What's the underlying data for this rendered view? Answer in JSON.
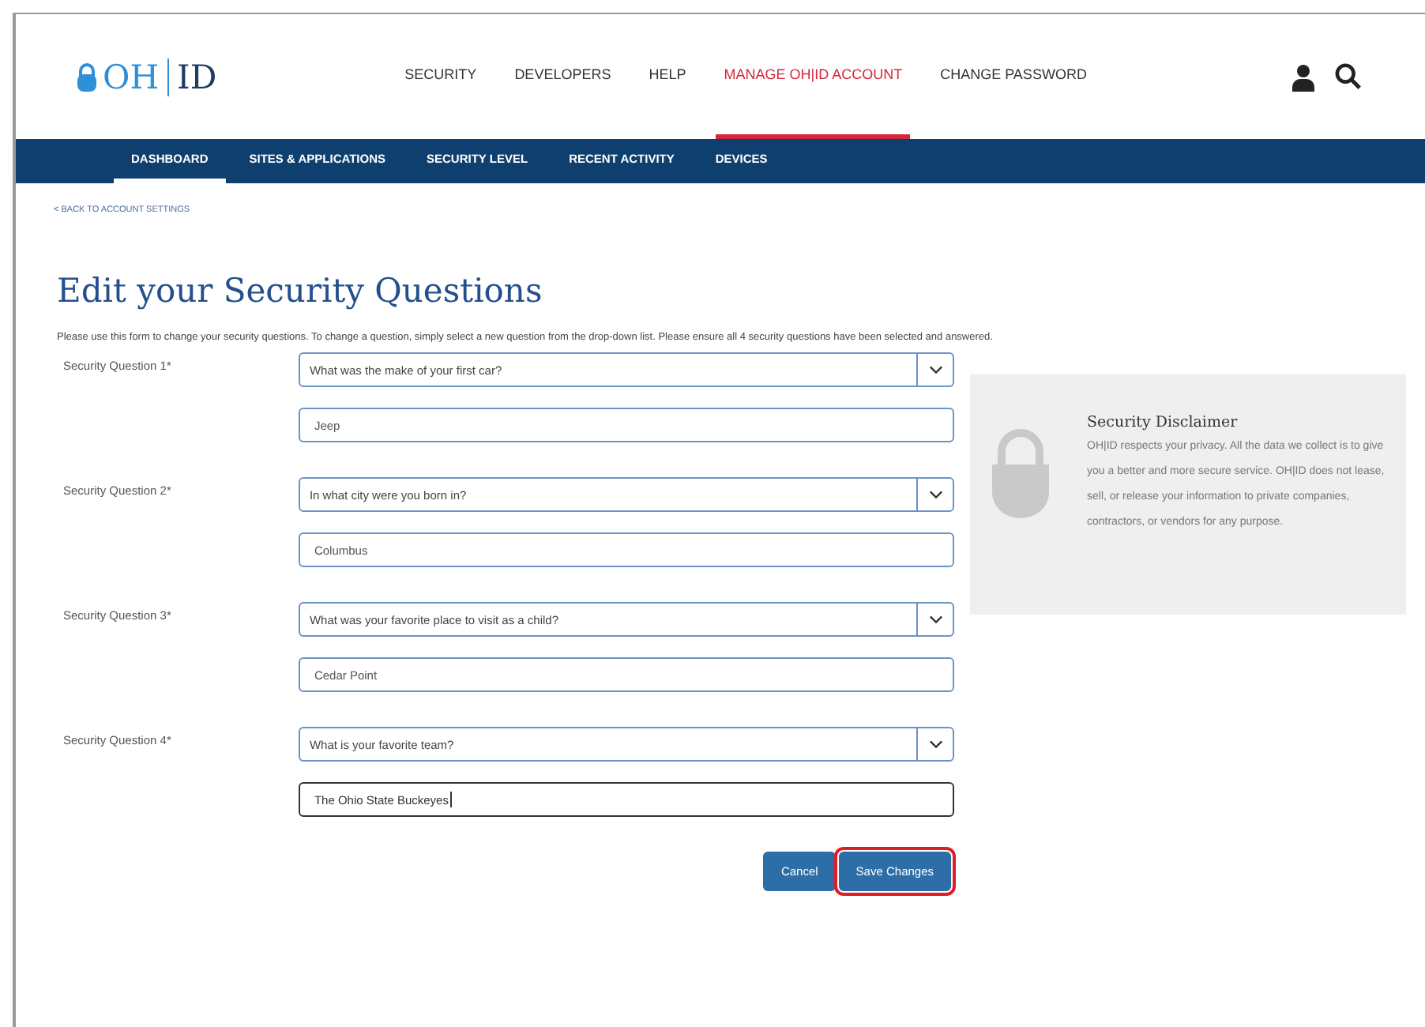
{
  "header": {
    "logo": {
      "left": "OH",
      "right": "ID"
    },
    "nav": [
      {
        "label": "SECURITY",
        "selected": false
      },
      {
        "label": "DEVELOPERS",
        "selected": false
      },
      {
        "label": "HELP",
        "selected": false
      },
      {
        "label": "MANAGE OH|ID ACCOUNT",
        "selected": true
      },
      {
        "label": "CHANGE PASSWORD",
        "selected": false
      }
    ]
  },
  "subnav": [
    {
      "label": "DASHBOARD",
      "selected": true
    },
    {
      "label": "SITES & APPLICATIONS",
      "selected": false
    },
    {
      "label": "SECURITY LEVEL",
      "selected": false
    },
    {
      "label": "RECENT ACTIVITY",
      "selected": false
    },
    {
      "label": "DEVICES",
      "selected": false
    }
  ],
  "back_link": "< BACK TO ACCOUNT SETTINGS",
  "title": "Edit your Security Questions",
  "intro": "Please use this form to change your security questions. To change a question, simply select a new question from the drop-down list. Please ensure all 4 security questions have been selected and answered.",
  "questions": [
    {
      "label": "Security Question 1*",
      "question": "What was the make of your first car?",
      "answer": "Jeep",
      "focused": false
    },
    {
      "label": "Security Question 2*",
      "question": "In what city were you born in?",
      "answer": "Columbus",
      "focused": false
    },
    {
      "label": "Security Question 3*",
      "question": "What was your favorite place to visit as a child?",
      "answer": "Cedar Point",
      "focused": false
    },
    {
      "label": "Security Question 4*",
      "question": "What is your favorite team?",
      "answer": "The Ohio State Buckeyes",
      "focused": true
    }
  ],
  "disclaimer": {
    "title": "Security Disclaimer",
    "text": "OH|ID respects your privacy. All the data we collect is to give you a better and more secure service. OH|ID does not lease, sell, or release your information to private companies, contractors, or vendors for any purpose."
  },
  "buttons": [
    {
      "label": "Cancel",
      "highlighted": false
    },
    {
      "label": "Save Changes",
      "highlighted": true
    }
  ]
}
